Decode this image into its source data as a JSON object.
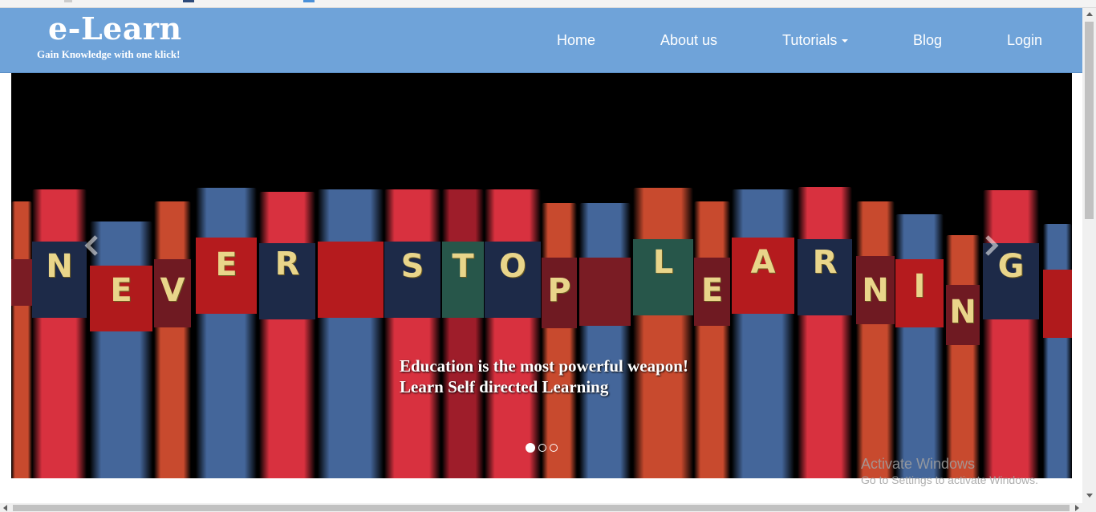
{
  "brand": {
    "title": "e-Learn",
    "tagline": "Gain Knowledge with one klick!"
  },
  "nav": {
    "home": "Home",
    "about": "About us",
    "tutorials": "Tutorials",
    "blog": "Blog",
    "login": "Login"
  },
  "carousel": {
    "caption_line1": "Education is the most powerful weapon!",
    "caption_line2": "Learn Self directed Learning",
    "slide_count": 3,
    "active_slide": 1,
    "book_letters": [
      "N",
      "E",
      "V",
      "E",
      "R",
      "S",
      "T",
      "O",
      "P",
      "L",
      "E",
      "A",
      "R",
      "N",
      "I",
      "N",
      "G"
    ]
  },
  "watermark": {
    "line1": "Activate Windows",
    "line2": "Go to Settings to activate Windows."
  },
  "colors": {
    "navbar": "#6fa3d9",
    "book_red": "#d8313f",
    "book_blue": "#44669a",
    "book_orange": "#c84a2e",
    "letter_gold": "#e9d58a"
  }
}
